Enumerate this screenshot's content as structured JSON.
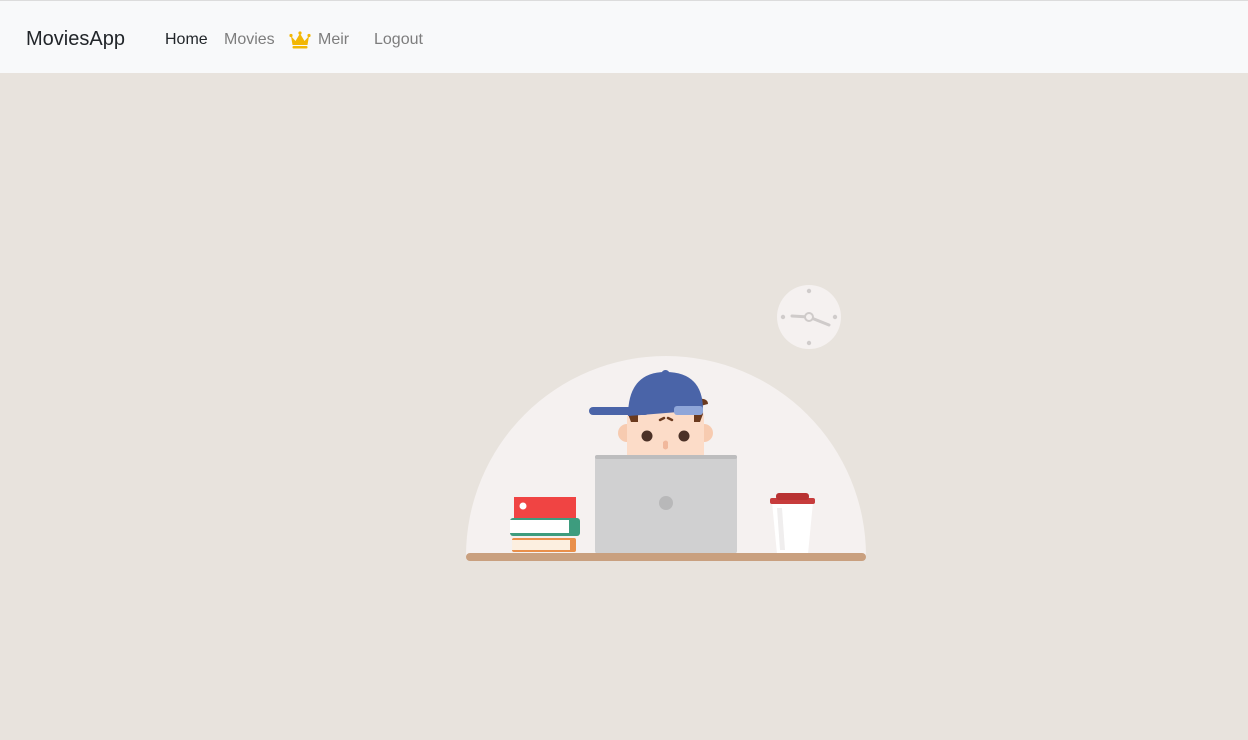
{
  "navbar": {
    "brand": "MoviesApp",
    "links": {
      "home": "Home",
      "movies": "Movies",
      "user": "Meir",
      "logout": "Logout"
    },
    "user_icon": "crown-icon",
    "active_link": "home"
  },
  "colors": {
    "page_background": "#e8e3dd",
    "navbar_background": "#f8f9fa",
    "crown": "#f2b705",
    "cap": "#4a64a8",
    "desk": "#c9a07f"
  },
  "illustration": {
    "elements": [
      "clock-icon",
      "person-with-cap",
      "laptop",
      "book-stack",
      "coffee-cup",
      "desk"
    ]
  }
}
